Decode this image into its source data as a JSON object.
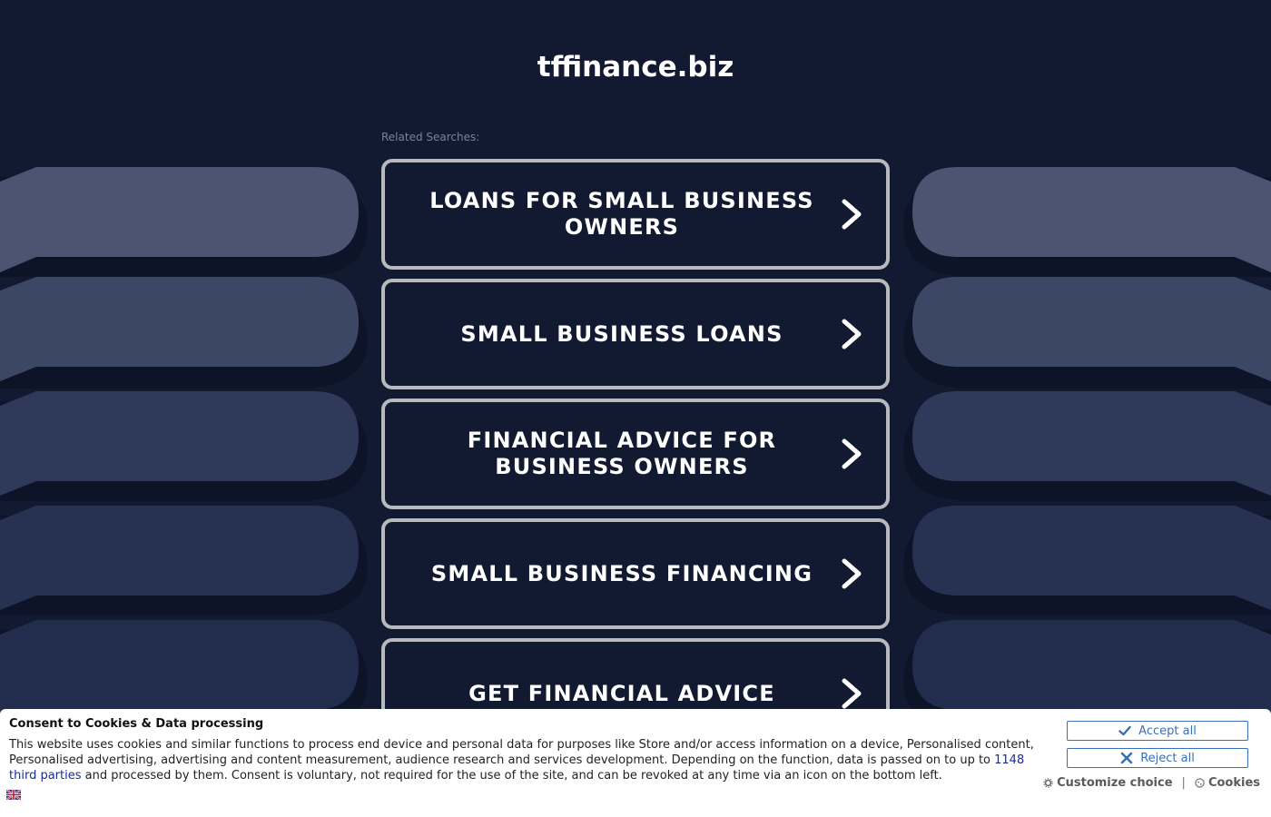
{
  "site": {
    "title": "tffinance.biz"
  },
  "related": {
    "label": "Related Searches:",
    "items": [
      {
        "label": "LOANS FOR SMALL BUSINESS OWNERS"
      },
      {
        "label": "SMALL BUSINESS LOANS"
      },
      {
        "label": "FINANCIAL ADVICE FOR BUSINESS OWNERS"
      },
      {
        "label": "SMALL BUSINESS FINANCING"
      },
      {
        "label": "GET FINANCIAL ADVICE"
      }
    ]
  },
  "consent": {
    "title": "Consent to Cookies & Data processing",
    "text_part1": "This website uses cookies and similar functions to process end device and personal data for purposes like Store and/or access information on a device, Personalised content, Personalised advertising, advertising and content measurement, audience research and services development. Depending on the function, data is passed on to up to ",
    "third_parties_link": "1148 third parties",
    "text_part2": " and processed by them. Consent is voluntary, not required for the use of the site, and can be revoked at any time via an icon on the bottom left.",
    "accept_label": "Accept all",
    "reject_label": "Reject all",
    "customize_label": "Customize choice",
    "separator": "|",
    "cookies_label": "Cookies"
  },
  "colors": {
    "background": "#111a30",
    "button_border": "#b7b9be",
    "consent_accent": "#3a6fb5"
  },
  "icons": {
    "chevron": "chevron-right-icon",
    "accept": "check-icon",
    "reject": "close-icon",
    "customize": "gear-icon",
    "cookies": "cookie-icon",
    "language": "uk-flag-icon"
  }
}
